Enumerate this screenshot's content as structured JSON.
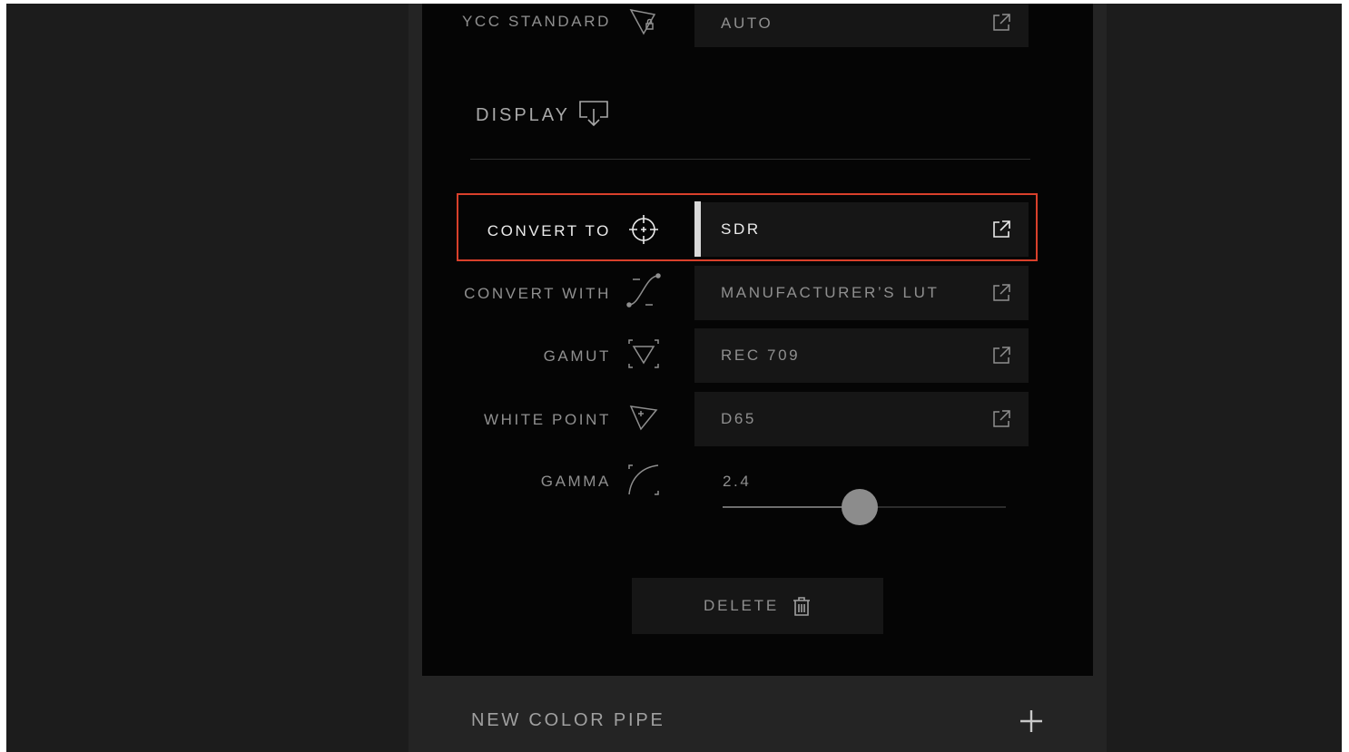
{
  "section": {
    "title": "DISPLAY",
    "icon": "display-output-icon"
  },
  "ycc_standard": {
    "label": "YCC STANDARD",
    "value": "AUTO",
    "icon": "gamut-lock-icon"
  },
  "convert_to": {
    "label": "CONVERT TO",
    "value": "SDR",
    "icon": "crosshair-target-icon",
    "selected": true
  },
  "convert_with": {
    "label": "CONVERT WITH",
    "value": "MANUFACTURER’S LUT",
    "icon": "curve-bezier-icon"
  },
  "gamut": {
    "label": "GAMUT",
    "value": "REC 709",
    "icon": "gamut-triangle-icon"
  },
  "white_point": {
    "label": "WHITE POINT",
    "value": "D65",
    "icon": "white-point-triangle-icon"
  },
  "gamma": {
    "label": "GAMMA",
    "value": "2.4",
    "icon": "gamma-curve-icon",
    "slider_fraction": 0.485
  },
  "delete": {
    "label": "DELETE",
    "icon": "trash-icon"
  },
  "new_pipe": {
    "label": "NEW COLOR PIPE",
    "icon": "plus-icon"
  },
  "colors": {
    "highlight_border": "#d9402b",
    "panel_bg": "#050505",
    "field_bg": "#161616",
    "text_dim": "#8f8f8f",
    "text_active": "#ebebeb"
  }
}
